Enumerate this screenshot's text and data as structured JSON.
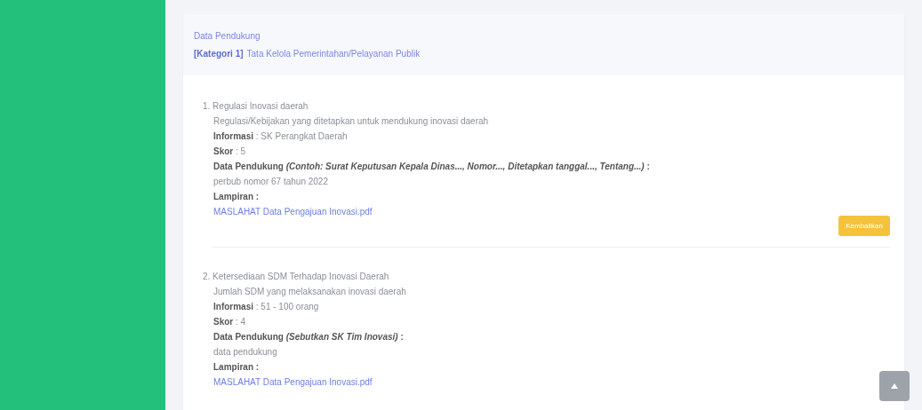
{
  "card_header": {
    "title": "Data Pendukung",
    "category_label": "[Kategori 1]",
    "category": "Tata Kelola Pemerintahan/Pelayanan Publik"
  },
  "items": [
    {
      "number": "1.",
      "title": "Regulasi Inovasi daerah",
      "description": "Regulasi/Kebijakan yang ditetapkan untuk mendukung inovasi daerah",
      "info_line": "**Informasi** : SK Perangkat Daerah",
      "score_line": "**Skor** : 5",
      "support_label": "Data Pendukung *(Contoh: Surat Keputusan Kepala Dinas..., Nomor..., Ditetapkan tanggal..., Tentang...)* :",
      "support": "perbub nomor 67 tahun 2022",
      "attachment_label": "Lampiran :",
      "attachment": "MASLAHAT Data Pengajuan Inovasi.pdf",
      "button": "Kembalikan"
    },
    {
      "number": "2.",
      "title": "Ketersediaan SDM Terhadap Inovasi Daerah",
      "description": "Jumlah SDM yang melaksanakan inovasi daerah",
      "info_line": "**Informasi** : 51 - 100 orang",
      "score_line": "**Skor** : 4",
      "support_label": "Data Pendukung *(Sebutkan SK Tim Inovasi)* :",
      "support": "data pendukung",
      "attachment_label": "Lampiran :",
      "attachment": "MASLAHAT Data Pengajuan Inovasi.pdf"
    }
  ]
}
